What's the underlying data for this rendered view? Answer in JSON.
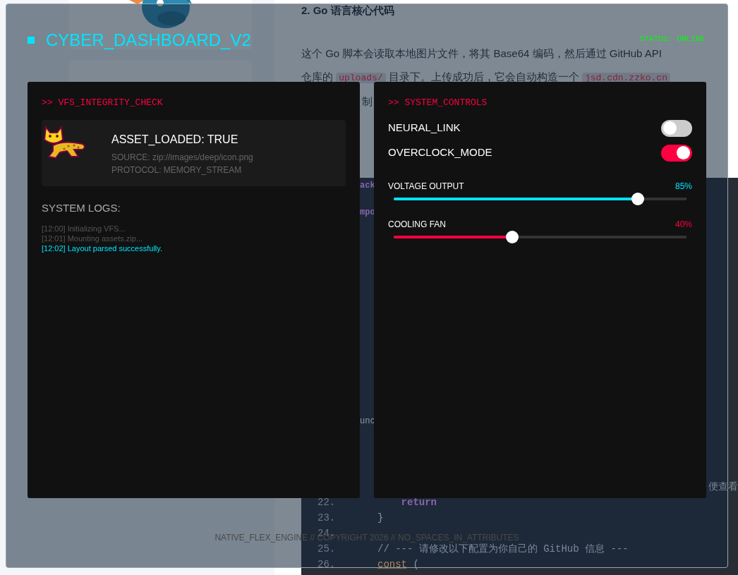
{
  "background_page": {
    "article": {
      "heading": "2. Go 语言核心代码",
      "lines": [
        {
          "segments": [
            {
              "kind": "text",
              "text": "这个 Go 脚本会读取本地图片文件，将其 Base64 编码，然后通过 GitHub API"
            }
          ]
        },
        {
          "segments": [
            {
              "kind": "text",
              "text": "仓库的 "
            },
            {
              "kind": "code",
              "text": "uploads/"
            },
            {
              "kind": "text",
              "text": " 目录下。上传成功后，它会自动构造一个 "
            },
            {
              "kind": "code",
              "text": "jsd.cdn.zzko.cn"
            }
          ]
        },
        {
          "kind": "fragment",
          "segments": [
            {
              "kind": "text",
              "text": "制"
            }
          ]
        }
      ]
    },
    "code_block": {
      "fragments": [
        {
          "kind": "keyword",
          "text": "ack"
        },
        {
          "kind": "keyword",
          "text": "mpo"
        },
        {
          "kind": "plain",
          "text": "unc"
        }
      ],
      "lines": [
        {
          "kind": "tail",
          "tokens": [
            {
              "kind": "comment",
              "text": "便查看"
            }
          ]
        },
        {
          "kind": "line",
          "number": "22.",
          "tokens": [
            {
              "kind": "keyword",
              "text": "    return"
            }
          ]
        },
        {
          "kind": "line",
          "number": "23.",
          "tokens": [
            {
              "kind": "plain",
              "text": "}"
            }
          ]
        },
        {
          "kind": "line",
          "number": "24."
        },
        {
          "kind": "line",
          "number": "25.",
          "tokens": [
            {
              "kind": "comment",
              "text": "// --- 请修改以下配置为你自己的 GitHub 信息 ---"
            }
          ]
        },
        {
          "kind": "line",
          "number": "26.",
          "tokens": [
            {
              "kind": "decl",
              "text": "const"
            },
            {
              "kind": "plain",
              "text": " ("
            }
          ]
        }
      ]
    }
  },
  "dashboard": {
    "title": "CYBER_DASHBOARD_V2",
    "status": "STATUS: ONLINE",
    "integrity_panel": {
      "title": ">> VFS_INTEGRITY_CHECK",
      "asset": {
        "headline": "ASSET_LOADED: TRUE",
        "source": "SOURCE: zip://images/deep/icon.png",
        "protocol": "PROTOCOL: MEMORY_STREAM"
      },
      "logs_title": "SYSTEM LOGS:",
      "logs": [
        {
          "kind": "info",
          "text": "[12:00] Initializing VFS..."
        },
        {
          "kind": "info",
          "text": "[12:01] Mounting assets.zip..."
        },
        {
          "kind": "success",
          "text": "[12:02] Layout parsed successfully."
        }
      ]
    },
    "controls_panel": {
      "title": ">> SYSTEM_CONTROLS",
      "toggles": [
        {
          "label": "NEURAL_LINK",
          "on": false
        },
        {
          "label": "OVERCLOCK_MODE",
          "on": true
        }
      ],
      "sliders": [
        {
          "label": "VOLTAGE OUTPUT",
          "reading": "85%",
          "level": 0.85,
          "color": "#00e5ff"
        },
        {
          "label": "COOLING FAN",
          "reading": "40%",
          "level": 0.4,
          "color": "#ff0040"
        }
      ]
    },
    "footer": "NATIVE_FLEX_ENGINE // COPYRIGHT 2026 // NO_SPACES_IN_ATTRIBUTES"
  }
}
